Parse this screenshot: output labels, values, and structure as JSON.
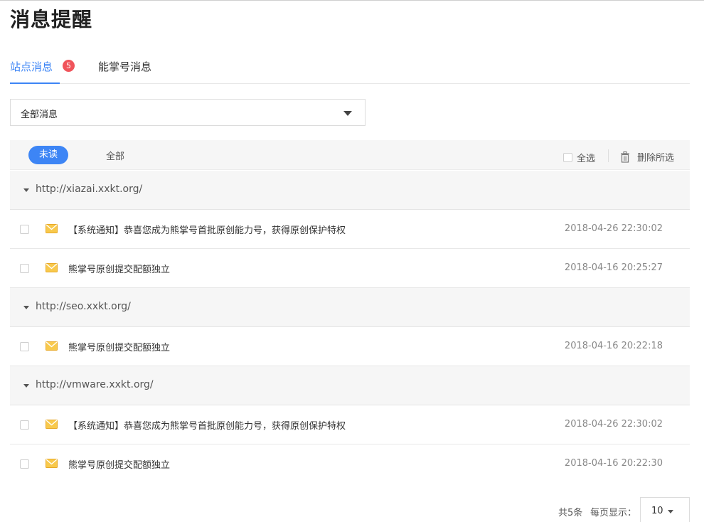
{
  "page": {
    "title": "消息提醒"
  },
  "tabs": [
    {
      "label": "站点消息",
      "badge": "5",
      "active": true
    },
    {
      "label": "能掌号消息",
      "active": false
    }
  ],
  "filter_select": {
    "value": "全部消息"
  },
  "toolbar": {
    "unread_label": "未读",
    "all_label": "全部",
    "select_all_label": "全选",
    "delete_selected_label": "删除所选"
  },
  "groups": [
    {
      "site": "http://xiazai.xxkt.org/",
      "messages": [
        {
          "text": "【系统通知】恭喜您成为熊掌号首批原创能力号，获得原创保护特权",
          "time": "2018-04-26 22:30:02"
        },
        {
          "text": "熊掌号原创提交配额独立",
          "time": "2018-04-16 20:25:27"
        }
      ]
    },
    {
      "site": "http://seo.xxkt.org/",
      "messages": [
        {
          "text": "熊掌号原创提交配额独立",
          "time": "2018-04-16 20:22:18"
        }
      ]
    },
    {
      "site": "http://vmware.xxkt.org/",
      "messages": [
        {
          "text": "【系统通知】恭喜您成为熊掌号首批原创能力号，获得原创保护特权",
          "time": "2018-04-26 22:30:02"
        },
        {
          "text": "熊掌号原创提交配额独立",
          "time": "2018-04-16 20:22:30"
        }
      ]
    }
  ],
  "pagination": {
    "total": "共5条",
    "per_page_label": "每页显示：",
    "page_size": "10"
  },
  "colors": {
    "accent": "#3d85f5",
    "badge": "#f0545b",
    "mail_icon": "#f3b233"
  },
  "icons": {
    "mail": "mail-icon",
    "trash": "trash-icon",
    "caret": "caret-down-icon"
  }
}
